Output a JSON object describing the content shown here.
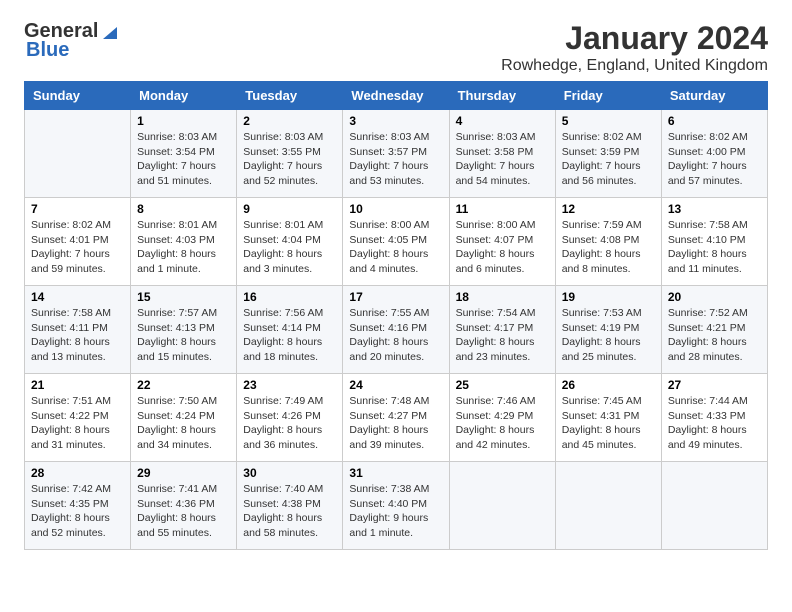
{
  "logo": {
    "general": "General",
    "blue": "Blue"
  },
  "title": "January 2024",
  "location": "Rowhedge, England, United Kingdom",
  "days_of_week": [
    "Sunday",
    "Monday",
    "Tuesday",
    "Wednesday",
    "Thursday",
    "Friday",
    "Saturday"
  ],
  "weeks": [
    [
      {
        "day": "",
        "info": ""
      },
      {
        "day": "1",
        "info": "Sunrise: 8:03 AM\nSunset: 3:54 PM\nDaylight: 7 hours\nand 51 minutes."
      },
      {
        "day": "2",
        "info": "Sunrise: 8:03 AM\nSunset: 3:55 PM\nDaylight: 7 hours\nand 52 minutes."
      },
      {
        "day": "3",
        "info": "Sunrise: 8:03 AM\nSunset: 3:57 PM\nDaylight: 7 hours\nand 53 minutes."
      },
      {
        "day": "4",
        "info": "Sunrise: 8:03 AM\nSunset: 3:58 PM\nDaylight: 7 hours\nand 54 minutes."
      },
      {
        "day": "5",
        "info": "Sunrise: 8:02 AM\nSunset: 3:59 PM\nDaylight: 7 hours\nand 56 minutes."
      },
      {
        "day": "6",
        "info": "Sunrise: 8:02 AM\nSunset: 4:00 PM\nDaylight: 7 hours\nand 57 minutes."
      }
    ],
    [
      {
        "day": "7",
        "info": "Sunrise: 8:02 AM\nSunset: 4:01 PM\nDaylight: 7 hours\nand 59 minutes."
      },
      {
        "day": "8",
        "info": "Sunrise: 8:01 AM\nSunset: 4:03 PM\nDaylight: 8 hours\nand 1 minute."
      },
      {
        "day": "9",
        "info": "Sunrise: 8:01 AM\nSunset: 4:04 PM\nDaylight: 8 hours\nand 3 minutes."
      },
      {
        "day": "10",
        "info": "Sunrise: 8:00 AM\nSunset: 4:05 PM\nDaylight: 8 hours\nand 4 minutes."
      },
      {
        "day": "11",
        "info": "Sunrise: 8:00 AM\nSunset: 4:07 PM\nDaylight: 8 hours\nand 6 minutes."
      },
      {
        "day": "12",
        "info": "Sunrise: 7:59 AM\nSunset: 4:08 PM\nDaylight: 8 hours\nand 8 minutes."
      },
      {
        "day": "13",
        "info": "Sunrise: 7:58 AM\nSunset: 4:10 PM\nDaylight: 8 hours\nand 11 minutes."
      }
    ],
    [
      {
        "day": "14",
        "info": "Sunrise: 7:58 AM\nSunset: 4:11 PM\nDaylight: 8 hours\nand 13 minutes."
      },
      {
        "day": "15",
        "info": "Sunrise: 7:57 AM\nSunset: 4:13 PM\nDaylight: 8 hours\nand 15 minutes."
      },
      {
        "day": "16",
        "info": "Sunrise: 7:56 AM\nSunset: 4:14 PM\nDaylight: 8 hours\nand 18 minutes."
      },
      {
        "day": "17",
        "info": "Sunrise: 7:55 AM\nSunset: 4:16 PM\nDaylight: 8 hours\nand 20 minutes."
      },
      {
        "day": "18",
        "info": "Sunrise: 7:54 AM\nSunset: 4:17 PM\nDaylight: 8 hours\nand 23 minutes."
      },
      {
        "day": "19",
        "info": "Sunrise: 7:53 AM\nSunset: 4:19 PM\nDaylight: 8 hours\nand 25 minutes."
      },
      {
        "day": "20",
        "info": "Sunrise: 7:52 AM\nSunset: 4:21 PM\nDaylight: 8 hours\nand 28 minutes."
      }
    ],
    [
      {
        "day": "21",
        "info": "Sunrise: 7:51 AM\nSunset: 4:22 PM\nDaylight: 8 hours\nand 31 minutes."
      },
      {
        "day": "22",
        "info": "Sunrise: 7:50 AM\nSunset: 4:24 PM\nDaylight: 8 hours\nand 34 minutes."
      },
      {
        "day": "23",
        "info": "Sunrise: 7:49 AM\nSunset: 4:26 PM\nDaylight: 8 hours\nand 36 minutes."
      },
      {
        "day": "24",
        "info": "Sunrise: 7:48 AM\nSunset: 4:27 PM\nDaylight: 8 hours\nand 39 minutes."
      },
      {
        "day": "25",
        "info": "Sunrise: 7:46 AM\nSunset: 4:29 PM\nDaylight: 8 hours\nand 42 minutes."
      },
      {
        "day": "26",
        "info": "Sunrise: 7:45 AM\nSunset: 4:31 PM\nDaylight: 8 hours\nand 45 minutes."
      },
      {
        "day": "27",
        "info": "Sunrise: 7:44 AM\nSunset: 4:33 PM\nDaylight: 8 hours\nand 49 minutes."
      }
    ],
    [
      {
        "day": "28",
        "info": "Sunrise: 7:42 AM\nSunset: 4:35 PM\nDaylight: 8 hours\nand 52 minutes."
      },
      {
        "day": "29",
        "info": "Sunrise: 7:41 AM\nSunset: 4:36 PM\nDaylight: 8 hours\nand 55 minutes."
      },
      {
        "day": "30",
        "info": "Sunrise: 7:40 AM\nSunset: 4:38 PM\nDaylight: 8 hours\nand 58 minutes."
      },
      {
        "day": "31",
        "info": "Sunrise: 7:38 AM\nSunset: 4:40 PM\nDaylight: 9 hours\nand 1 minute."
      },
      {
        "day": "",
        "info": ""
      },
      {
        "day": "",
        "info": ""
      },
      {
        "day": "",
        "info": ""
      }
    ]
  ]
}
